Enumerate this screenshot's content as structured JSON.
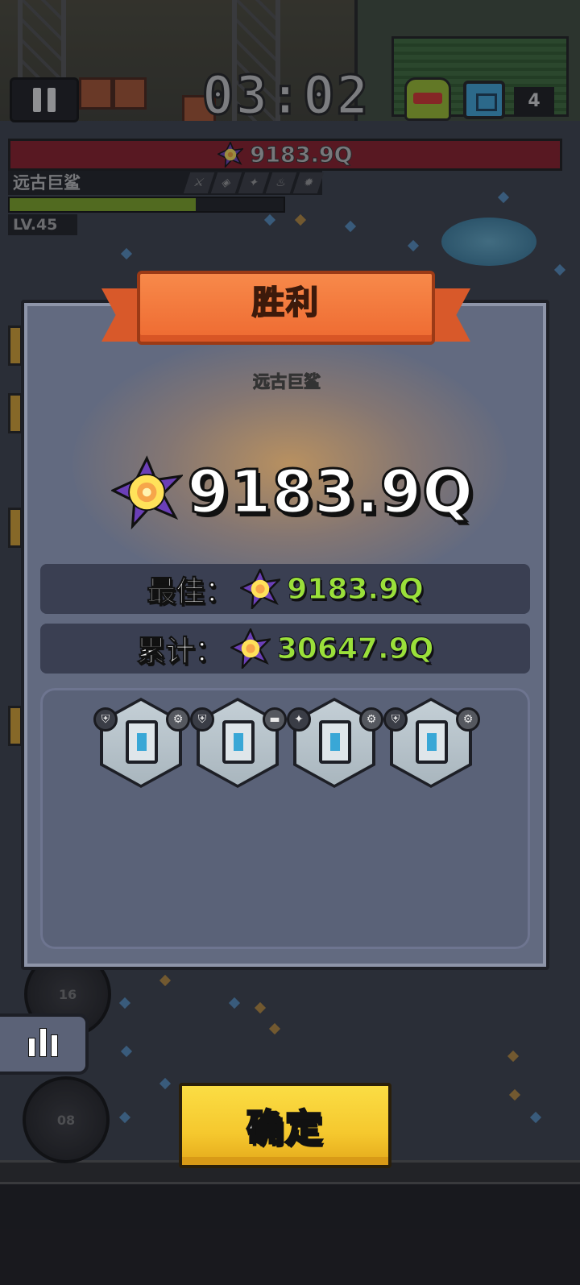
{
  "hud": {
    "timer": "03:02",
    "chest_count": "4",
    "boss_hp_value": "9183.9Q",
    "boss_name": "远古巨鲨",
    "boss_level": "LV.45",
    "boss_xp_fraction": 0.68,
    "trait_icons": [
      "sword-icon",
      "shield-icon",
      "claw-icon",
      "flame-icon",
      "gear-icon"
    ]
  },
  "result": {
    "title": "胜利",
    "enemy_name": "远古巨鲨",
    "damage": "9183.9Q",
    "best_label": "最佳：",
    "best_value": "9183.9Q",
    "total_label": "累计：",
    "total_value": "30647.9Q",
    "equipment": [
      {
        "name": "armor-piece-1",
        "badge_left": "shield-icon",
        "badge_right": "gear-icon"
      },
      {
        "name": "armor-piece-2",
        "badge_left": "shield-icon",
        "badge_right": "plate-icon"
      },
      {
        "name": "armor-piece-3",
        "badge_left": "claw-icon",
        "badge_right": "gear-icon"
      },
      {
        "name": "armor-piece-4",
        "badge_left": "shield-icon",
        "badge_right": "gear-icon"
      }
    ]
  },
  "controls": {
    "confirm_label": "确定",
    "skill_1_level": "16",
    "skill_2_level": "08"
  },
  "colors": {
    "victory_ribbon": "#ee6a31",
    "highlight_green": "#9be03a",
    "confirm_yellow": "#f5c82e",
    "panel": "#626a80"
  }
}
